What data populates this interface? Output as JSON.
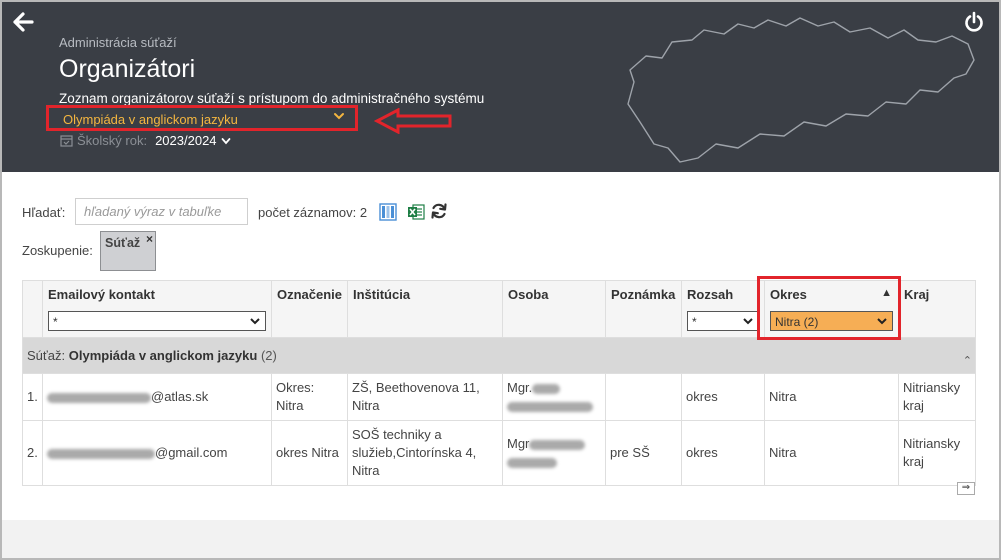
{
  "header": {
    "breadcrumb": "Administrácia súťaží",
    "title": "Organizátori",
    "subtitle": "Zoznam organizátorov súťaží s prístupom do administračného systému",
    "competition_select": "Olympiáda v anglickom jazyku",
    "school_year_label": "Školský rok:",
    "school_year_value": "2023/2024"
  },
  "toolbar": {
    "search_label": "Hľadať:",
    "search_placeholder": "hľadaný výraz v tabuľke",
    "count_text": "počet záznamov: 2"
  },
  "grouping": {
    "label": "Zoskupenie:",
    "chip": "Súťaž",
    "chip_close": "×"
  },
  "table": {
    "columns": [
      "Emailový kontakt",
      "Označenie",
      "Inštitúcia",
      "Osoba",
      "Poznámka",
      "Rozsah",
      "Okres",
      "Kraj"
    ],
    "filters": {
      "email": "*",
      "rozsah": "*",
      "okres": "Nitra (2)"
    },
    "group_row": {
      "prefix": "Súťaž: ",
      "name": "Olympiáda v anglickom jazyku",
      "count": "(2)"
    },
    "rows": [
      {
        "num": "1.",
        "email_suffix": "@atlas.sk",
        "oznacenie": "Okres: Nitra",
        "institucia": "ZŠ, Beethovenova 11, Nitra",
        "osoba_prefix": "Mgr.",
        "poznamka": "",
        "rozsah": "okres",
        "okres": "Nitra",
        "kraj": "Nitriansky kraj"
      },
      {
        "num": "2.",
        "email_suffix": "@gmail.com",
        "oznacenie": "okres Nitra",
        "institucia": "SOŠ techniky a služieb,Cintorínska 4, Nitra",
        "osoba_prefix": "Mgr",
        "poznamka": "pre SŠ",
        "rozsah": "okres",
        "okres": "Nitra",
        "kraj": "Nitriansky kraj"
      }
    ],
    "scroll_right": "⇒"
  }
}
